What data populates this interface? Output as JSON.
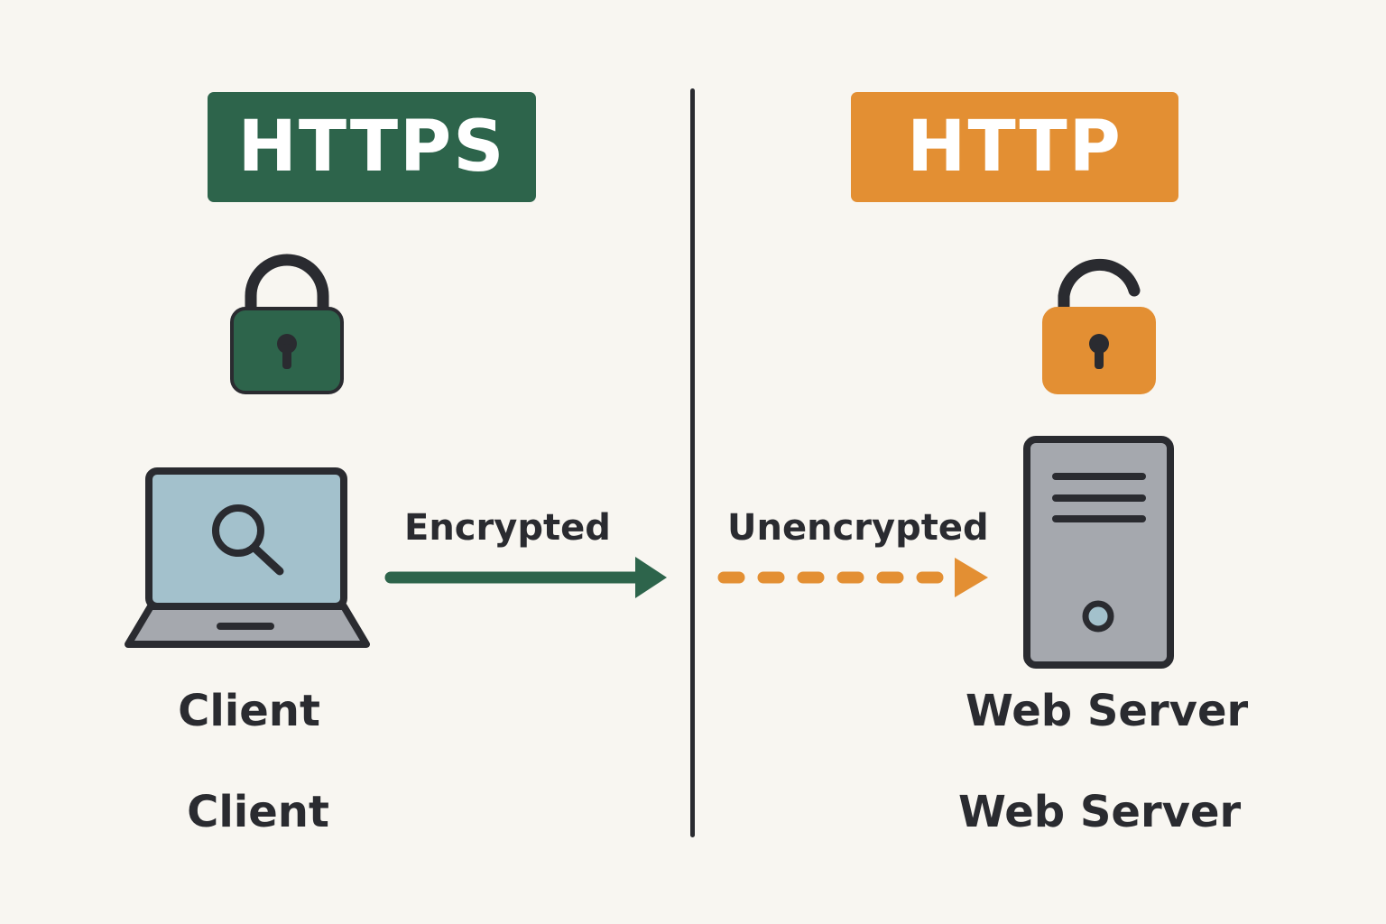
{
  "https": {
    "label": "HTTPS",
    "color": "#2d644b",
    "flow_label": "Encrypted"
  },
  "http": {
    "label": "HTTP",
    "color": "#e38f33",
    "flow_label": "Unencrypted"
  },
  "client": {
    "label_primary": "Client",
    "label_secondary": "Client"
  },
  "server": {
    "label_primary": "Web Server",
    "label_secondary": "Web Server"
  },
  "colors": {
    "background": "#f8f6f1",
    "outline": "#2a2b30",
    "screen": "#a3c1cc",
    "device_gray": "#a5a8ae"
  }
}
